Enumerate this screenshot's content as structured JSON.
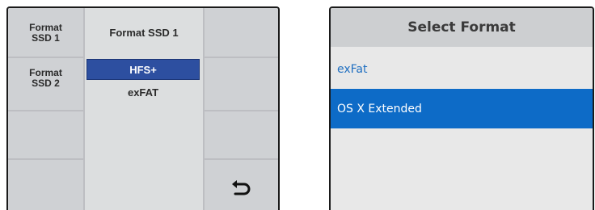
{
  "left_panel": {
    "left_buttons": [
      "Format\nSSD 1",
      "Format\nSSD 2",
      "",
      ""
    ],
    "right_buttons": [
      "",
      "",
      "",
      ""
    ],
    "center_title": "Format SSD 1",
    "options": [
      {
        "label": "HFS+",
        "selected": true
      },
      {
        "label": "exFAT",
        "selected": false
      }
    ],
    "return_icon": "return-arrow-icon"
  },
  "right_panel": {
    "title": "Select Format",
    "items": [
      {
        "label": "exFat",
        "highlighted": false
      },
      {
        "label": "OS X Extended",
        "highlighted": true
      }
    ]
  },
  "colors": {
    "selection_blue": "#2d4fa0",
    "menu_highlight": "#0d6bc7",
    "menu_text_blue": "#1f6fc1"
  }
}
